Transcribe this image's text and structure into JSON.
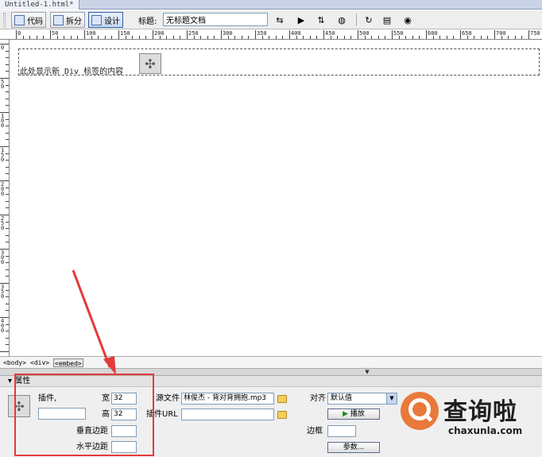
{
  "document_tab": "Untitled-1.html*",
  "toolbar": {
    "code_label": "代码",
    "split_label": "拆分",
    "design_label": "设计",
    "title_label": "标题:",
    "title_value": "无标题文档"
  },
  "ruler": {
    "top_numbers": [
      "0",
      "50",
      "100",
      "150",
      "200",
      "250",
      "300",
      "350",
      "400",
      "450",
      "500",
      "550",
      "600",
      "650",
      "700",
      "750"
    ],
    "left_numbers": [
      "0",
      "50",
      "100",
      "150",
      "200",
      "250",
      "300",
      "350",
      "400"
    ]
  },
  "canvas": {
    "div_text": "此处显示新 Div 标签的内容",
    "plugin_icon": "plugin-icon"
  },
  "statusbar": {
    "tags": [
      "<body>",
      "<div>",
      "<embed>"
    ]
  },
  "properties": {
    "header": "属性",
    "plugin_label": "插件,",
    "width_label": "宽",
    "width_value": "32",
    "height_label": "高",
    "height_value": "32",
    "src_label": "源文件",
    "src_value": "林俊杰 - 背对背拥抱.mp3",
    "plg_url_label": "插件URL",
    "plg_url_value": "",
    "align_label": "对齐",
    "align_value": "默认值",
    "play_button": "播放",
    "vspace_label": "垂直边距",
    "hspace_label": "水平边距",
    "border_label": "边框",
    "params_button": "参数..."
  },
  "watermark": {
    "main": "查询啦",
    "sub": "chaxunla.com"
  },
  "colors": {
    "annotation": "#e33a3a",
    "watermark_orange": "#e8793a",
    "field_border": "#7f9db9"
  }
}
